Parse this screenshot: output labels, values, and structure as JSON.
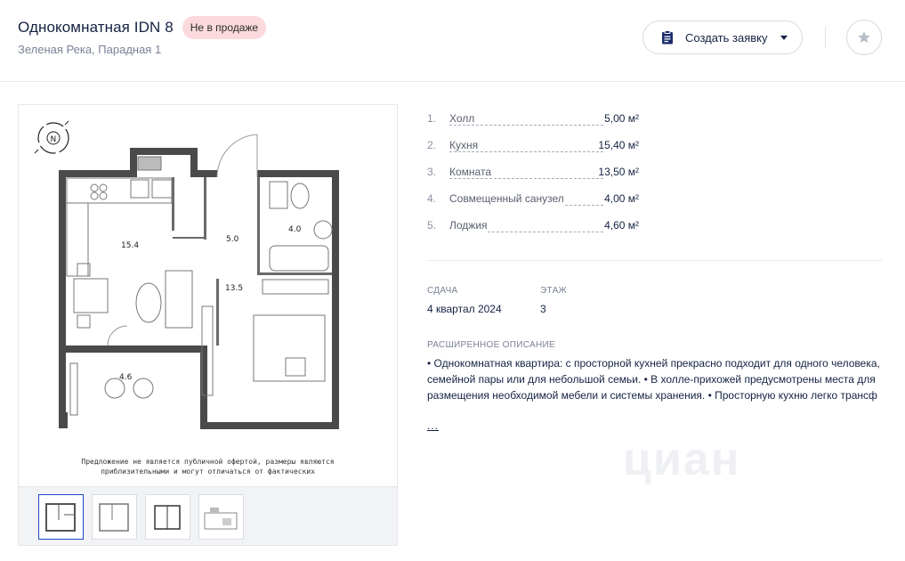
{
  "header": {
    "title": "Однокомнатная IDN 8",
    "status_badge": "Не в продаже",
    "address": "Зеленая Река, Парадная 1",
    "request_button": "Создать заявку"
  },
  "plan": {
    "compass_label": "N",
    "room_labels": [
      "15.4",
      "5.0",
      "4.0",
      "13.5",
      "4.6"
    ],
    "disclaimer_line1": "Предложение не является публичной офертой, размеры являются",
    "disclaimer_line2": "приблизительными и могут отличаться от фактических",
    "thumbnails": [
      "Планировка 1",
      "Планировка 2",
      "Планировка 3",
      "Планировка 4"
    ],
    "active_thumbnail": 0
  },
  "rooms": [
    {
      "num": "1.",
      "name": "Холл",
      "area": "5,00 м²"
    },
    {
      "num": "2.",
      "name": "Кухня",
      "area": "15,40 м²"
    },
    {
      "num": "3.",
      "name": "Комната",
      "area": "13,50 м²"
    },
    {
      "num": "4.",
      "name": "Совмещенный санузел",
      "area": "4,00 м²"
    },
    {
      "num": "5.",
      "name": "Лоджия",
      "area": "4,60 м²"
    }
  ],
  "details": {
    "delivery_label": "СДАЧА",
    "delivery_value": "4 квартал 2024",
    "floor_label": "ЭТАЖ",
    "floor_value": "3"
  },
  "description": {
    "label": "РАСШИРЕННОЕ ОПИСАНИЕ",
    "text": "• Однокомнатная квартира: с просторной кухней прекрасно подходит для одного человека, семейной пары или для небольшой семьи. • В холле-прихожей предусмотрены места для размещения необходимой мебели и системы хранения. • Просторную кухню легко трансф",
    "more_link": "..."
  },
  "watermark": "циан",
  "colors": {
    "accent": "#1a46c4",
    "badge_bg": "#fbd9dc",
    "wall": "#4a4a4a"
  }
}
